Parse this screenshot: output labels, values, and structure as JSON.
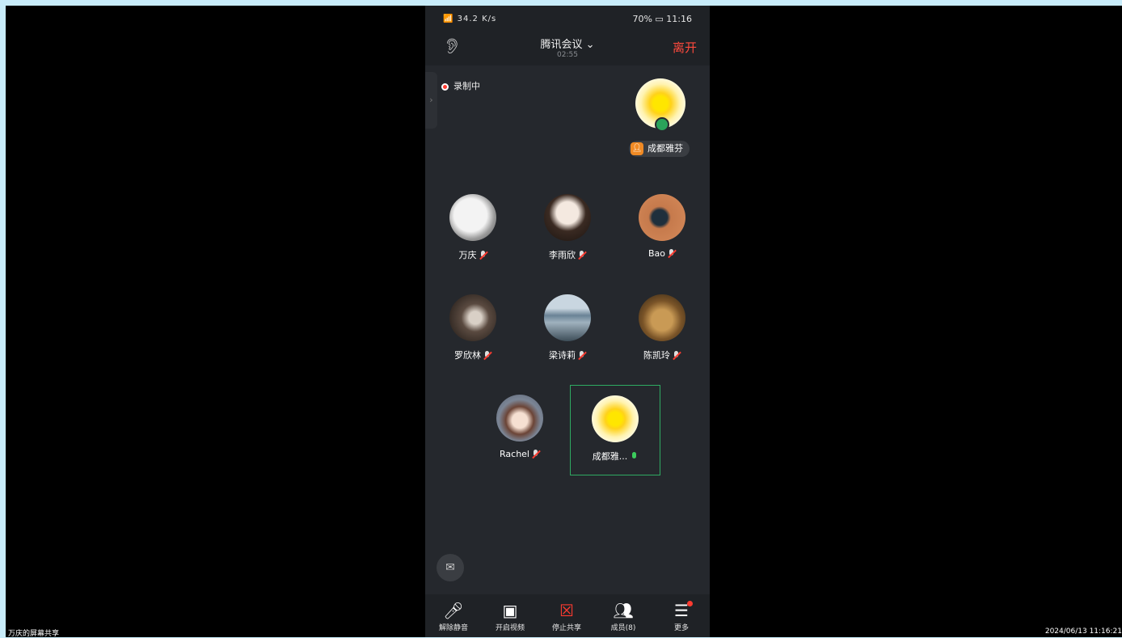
{
  "status": {
    "left": "📶 34.2 K/s",
    "right": "70% ▭ 11:16"
  },
  "header": {
    "title": "腾讯会议",
    "timer": "02:55",
    "leave": "离开"
  },
  "recording": "录制中",
  "speaker": {
    "name": "成都雅芬"
  },
  "participants": [
    {
      "name": "万庆",
      "muted": true
    },
    {
      "name": "李雨欣",
      "muted": true
    },
    {
      "name": "Bao",
      "muted": true
    },
    {
      "name": "罗欣林",
      "muted": true
    },
    {
      "name": "梁诗莉",
      "muted": true
    },
    {
      "name": "陈凯玲",
      "muted": true
    },
    {
      "name": "Rachel",
      "muted": true
    },
    {
      "name": "成都雅...",
      "muted": false
    }
  ],
  "toolbar": {
    "unmute": "解除静音",
    "video": "开启视频",
    "stop_share": "停止共享",
    "members": "成员(8)",
    "more": "更多"
  },
  "footer": {
    "left": "万庆的屏幕共享",
    "right": "2024/06/13 11:16:21"
  }
}
